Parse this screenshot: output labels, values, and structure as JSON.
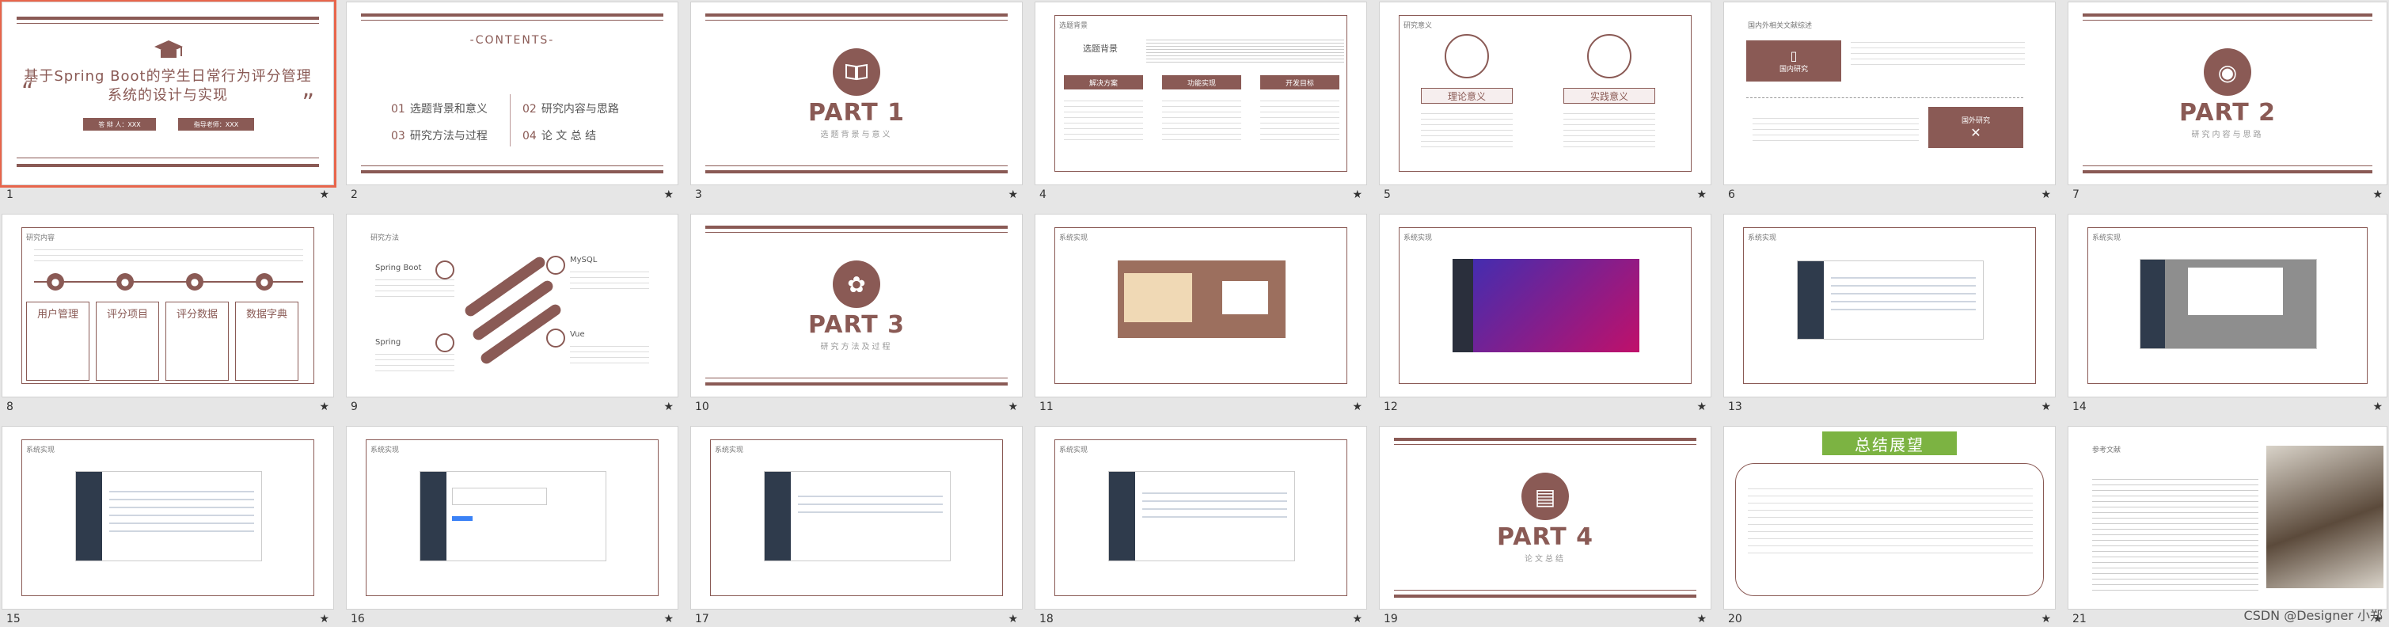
{
  "colors": {
    "accent": "#8a5a55",
    "selected": "#e8654b",
    "summary_green": "#7cb342"
  },
  "slide1": {
    "title": "基于Spring Boot的学生日常行为评分管理系统的设计与实现",
    "presenter": "答 辩 人：XXX",
    "advisor": "指导老师：XXX",
    "icon": "graduation-cap-icon"
  },
  "slide2": {
    "heading": "-CONTENTS-",
    "items": [
      {
        "no": "01",
        "text": "选题背景和意义"
      },
      {
        "no": "02",
        "text": "研究内容与思路"
      },
      {
        "no": "03",
        "text": "研究方法与过程"
      },
      {
        "no": "04",
        "text": "论 文 总 结"
      }
    ]
  },
  "slide3": {
    "part": "PART 1",
    "sub": "选题背景与意义",
    "icon": "book-icon"
  },
  "slide4": {
    "section": "选题背景",
    "heading": "选题背景",
    "labels": [
      "解决方案",
      "功能实现",
      "开发目标"
    ]
  },
  "slide5": {
    "section": "研究意义",
    "cards": [
      "理论意义",
      "实践意义"
    ]
  },
  "slide6": {
    "section": "国内外相关文献综述",
    "domestic": "国内研究",
    "foreign": "国外研究"
  },
  "slide7": {
    "part": "PART 2",
    "sub": "研究内容与思路",
    "icon": "lightbulb-icon"
  },
  "slide8": {
    "section": "研究内容",
    "cards": [
      "用户管理",
      "评分项目",
      "评分数据",
      "数据字典"
    ]
  },
  "slide9": {
    "section": "研究方法",
    "techs": [
      "Spring Boot",
      "MySQL",
      "Spring",
      "Vue"
    ]
  },
  "slide10": {
    "part": "PART 3",
    "sub": "研究方法及过程",
    "icon": "people-icon"
  },
  "slide11": {
    "section": "系统实现"
  },
  "slide12": {
    "section": "系统实现"
  },
  "slide13": {
    "section": "系统实现"
  },
  "slide14": {
    "section": "系统实现"
  },
  "slide15": {
    "section": "系统实现"
  },
  "slide16": {
    "section": "系统实现"
  },
  "slide17": {
    "section": "系统实现"
  },
  "slide18": {
    "section": "系统实现"
  },
  "slide19": {
    "part": "PART 4",
    "sub": "论文总结",
    "icon": "document-icon"
  },
  "slide20": {
    "heading": "总结展望"
  },
  "slide21": {
    "section": "参考文献"
  },
  "slide_numbers": [
    "1",
    "2",
    "3",
    "4",
    "5",
    "6",
    "7",
    "8",
    "9",
    "10",
    "11",
    "12",
    "13",
    "14",
    "15",
    "16",
    "17",
    "18",
    "19",
    "20",
    "21"
  ],
  "star": "★",
  "watermark": "CSDN @Designer 小郑"
}
